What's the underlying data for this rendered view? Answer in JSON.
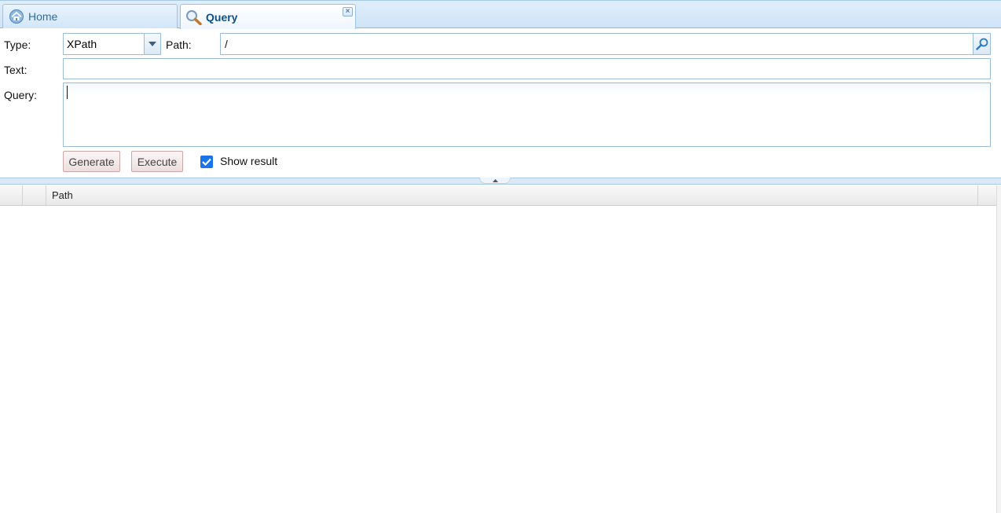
{
  "tabs": [
    {
      "label": "Home",
      "icon": "home-icon"
    },
    {
      "label": "Query",
      "icon": "magnifier-icon",
      "closable": true
    }
  ],
  "form": {
    "type_label": "Type:",
    "type_value": "XPath",
    "path_label": "Path:",
    "path_value": "/",
    "text_label": "Text:",
    "text_value": "",
    "query_label": "Query:",
    "query_value": ""
  },
  "buttons": {
    "generate": "Generate",
    "execute": "Execute"
  },
  "show_result": {
    "label": "Show result",
    "checked": true
  },
  "grid": {
    "columns": [
      "",
      "",
      "Path"
    ]
  },
  "colors": {
    "accent": "#1a73e8",
    "tab_active_text": "#0d4e8c",
    "tab_text": "#2e6da4"
  }
}
